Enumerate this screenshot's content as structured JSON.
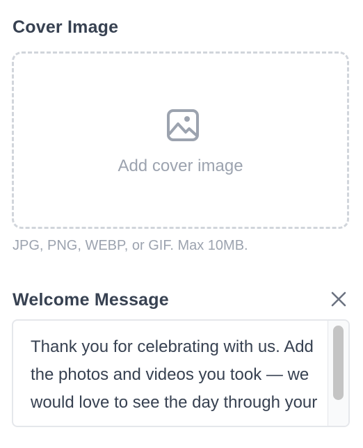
{
  "cover_image": {
    "label": "Cover Image",
    "dropzone_text": "Add cover image",
    "icon": "image-icon",
    "help_text": "JPG, PNG, WEBP, or GIF. Max 10MB."
  },
  "welcome_message": {
    "label": "Welcome Message",
    "close_icon": "close-icon",
    "value": "Thank you for celebrating with us. Add the photos and videos you took — we would love to see the day through your eyes."
  }
}
